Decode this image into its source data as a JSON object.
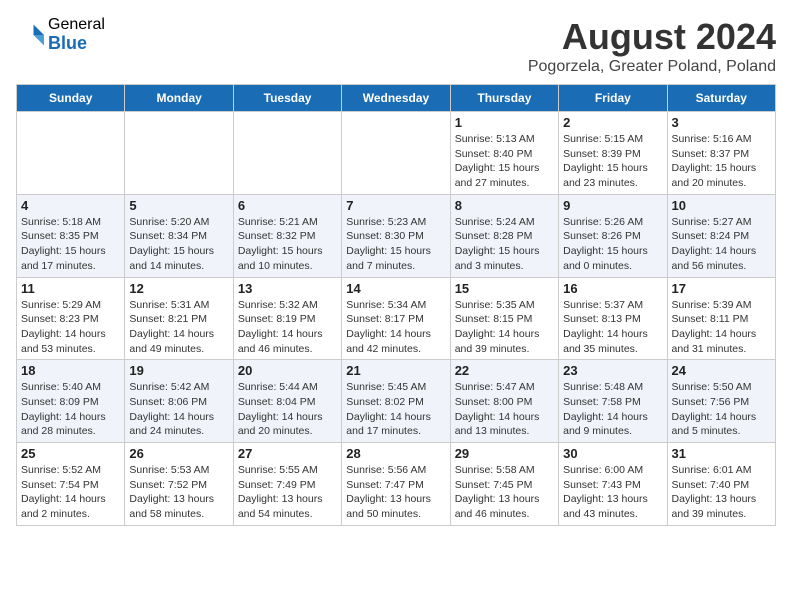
{
  "header": {
    "logo_general": "General",
    "logo_blue": "Blue",
    "title": "August 2024",
    "subtitle": "Pogorzela, Greater Poland, Poland"
  },
  "calendar": {
    "days": [
      "Sunday",
      "Monday",
      "Tuesday",
      "Wednesday",
      "Thursday",
      "Friday",
      "Saturday"
    ],
    "weeks": [
      [
        {
          "num": "",
          "info": ""
        },
        {
          "num": "",
          "info": ""
        },
        {
          "num": "",
          "info": ""
        },
        {
          "num": "",
          "info": ""
        },
        {
          "num": "1",
          "info": "Sunrise: 5:13 AM\nSunset: 8:40 PM\nDaylight: 15 hours\nand 27 minutes."
        },
        {
          "num": "2",
          "info": "Sunrise: 5:15 AM\nSunset: 8:39 PM\nDaylight: 15 hours\nand 23 minutes."
        },
        {
          "num": "3",
          "info": "Sunrise: 5:16 AM\nSunset: 8:37 PM\nDaylight: 15 hours\nand 20 minutes."
        }
      ],
      [
        {
          "num": "4",
          "info": "Sunrise: 5:18 AM\nSunset: 8:35 PM\nDaylight: 15 hours\nand 17 minutes."
        },
        {
          "num": "5",
          "info": "Sunrise: 5:20 AM\nSunset: 8:34 PM\nDaylight: 15 hours\nand 14 minutes."
        },
        {
          "num": "6",
          "info": "Sunrise: 5:21 AM\nSunset: 8:32 PM\nDaylight: 15 hours\nand 10 minutes."
        },
        {
          "num": "7",
          "info": "Sunrise: 5:23 AM\nSunset: 8:30 PM\nDaylight: 15 hours\nand 7 minutes."
        },
        {
          "num": "8",
          "info": "Sunrise: 5:24 AM\nSunset: 8:28 PM\nDaylight: 15 hours\nand 3 minutes."
        },
        {
          "num": "9",
          "info": "Sunrise: 5:26 AM\nSunset: 8:26 PM\nDaylight: 15 hours\nand 0 minutes."
        },
        {
          "num": "10",
          "info": "Sunrise: 5:27 AM\nSunset: 8:24 PM\nDaylight: 14 hours\nand 56 minutes."
        }
      ],
      [
        {
          "num": "11",
          "info": "Sunrise: 5:29 AM\nSunset: 8:23 PM\nDaylight: 14 hours\nand 53 minutes."
        },
        {
          "num": "12",
          "info": "Sunrise: 5:31 AM\nSunset: 8:21 PM\nDaylight: 14 hours\nand 49 minutes."
        },
        {
          "num": "13",
          "info": "Sunrise: 5:32 AM\nSunset: 8:19 PM\nDaylight: 14 hours\nand 46 minutes."
        },
        {
          "num": "14",
          "info": "Sunrise: 5:34 AM\nSunset: 8:17 PM\nDaylight: 14 hours\nand 42 minutes."
        },
        {
          "num": "15",
          "info": "Sunrise: 5:35 AM\nSunset: 8:15 PM\nDaylight: 14 hours\nand 39 minutes."
        },
        {
          "num": "16",
          "info": "Sunrise: 5:37 AM\nSunset: 8:13 PM\nDaylight: 14 hours\nand 35 minutes."
        },
        {
          "num": "17",
          "info": "Sunrise: 5:39 AM\nSunset: 8:11 PM\nDaylight: 14 hours\nand 31 minutes."
        }
      ],
      [
        {
          "num": "18",
          "info": "Sunrise: 5:40 AM\nSunset: 8:09 PM\nDaylight: 14 hours\nand 28 minutes."
        },
        {
          "num": "19",
          "info": "Sunrise: 5:42 AM\nSunset: 8:06 PM\nDaylight: 14 hours\nand 24 minutes."
        },
        {
          "num": "20",
          "info": "Sunrise: 5:44 AM\nSunset: 8:04 PM\nDaylight: 14 hours\nand 20 minutes."
        },
        {
          "num": "21",
          "info": "Sunrise: 5:45 AM\nSunset: 8:02 PM\nDaylight: 14 hours\nand 17 minutes."
        },
        {
          "num": "22",
          "info": "Sunrise: 5:47 AM\nSunset: 8:00 PM\nDaylight: 14 hours\nand 13 minutes."
        },
        {
          "num": "23",
          "info": "Sunrise: 5:48 AM\nSunset: 7:58 PM\nDaylight: 14 hours\nand 9 minutes."
        },
        {
          "num": "24",
          "info": "Sunrise: 5:50 AM\nSunset: 7:56 PM\nDaylight: 14 hours\nand 5 minutes."
        }
      ],
      [
        {
          "num": "25",
          "info": "Sunrise: 5:52 AM\nSunset: 7:54 PM\nDaylight: 14 hours\nand 2 minutes."
        },
        {
          "num": "26",
          "info": "Sunrise: 5:53 AM\nSunset: 7:52 PM\nDaylight: 13 hours\nand 58 minutes."
        },
        {
          "num": "27",
          "info": "Sunrise: 5:55 AM\nSunset: 7:49 PM\nDaylight: 13 hours\nand 54 minutes."
        },
        {
          "num": "28",
          "info": "Sunrise: 5:56 AM\nSunset: 7:47 PM\nDaylight: 13 hours\nand 50 minutes."
        },
        {
          "num": "29",
          "info": "Sunrise: 5:58 AM\nSunset: 7:45 PM\nDaylight: 13 hours\nand 46 minutes."
        },
        {
          "num": "30",
          "info": "Sunrise: 6:00 AM\nSunset: 7:43 PM\nDaylight: 13 hours\nand 43 minutes."
        },
        {
          "num": "31",
          "info": "Sunrise: 6:01 AM\nSunset: 7:40 PM\nDaylight: 13 hours\nand 39 minutes."
        }
      ]
    ]
  }
}
